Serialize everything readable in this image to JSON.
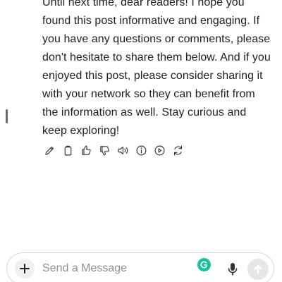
{
  "message": {
    "text": "Until next time, dear readers! I hope you found this post informative and engaging. If you have any questions or comments, please don't hesitate to share them below. And if you enjoyed this post, please consider sharing it with your network so they can benefit from the information as well. Stay curious and keep exploring!"
  },
  "actions": {
    "icons": [
      "edit-icon",
      "copy-icon",
      "thumbs-up-icon",
      "thumbs-down-icon",
      "speaker-icon",
      "info-icon",
      "play-icon",
      "regenerate-icon"
    ]
  },
  "composer": {
    "placeholder": "Send a Message",
    "value": ""
  },
  "colors": {
    "text": "#1f1f1f",
    "icon": "#333333",
    "grammarly": "#15c39a",
    "send_disabled": "#e6e6e6",
    "border": "#d9d9d9"
  }
}
